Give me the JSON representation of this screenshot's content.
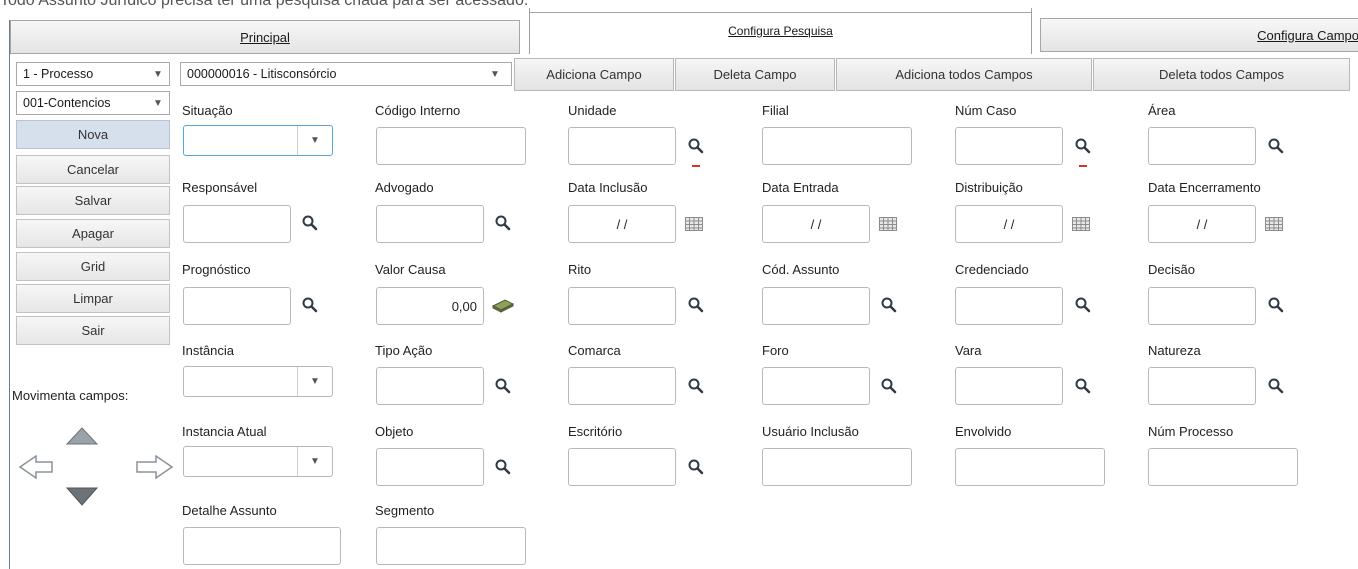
{
  "caption": "Todo Assunto Jurídico precisa ter uma pesquisa criada para ser acessado.",
  "tabs": {
    "principal": "Principal",
    "pesquisa": "Configura Pesquisa",
    "campo": "Configura Campo"
  },
  "filters": {
    "tipo": "1 - Processo",
    "pesquisa": "000000016 - Litisconsórcio",
    "assunto": "001-Contencios"
  },
  "toolbar": {
    "adiciona": "Adiciona Campo",
    "deleta": "Deleta Campo",
    "adiciona_todos": "Adiciona todos Campos",
    "deleta_todos": "Deleta todos Campos"
  },
  "sidebar": {
    "buttons": [
      "Nova",
      "Cancelar",
      "Salvar",
      "Apagar",
      "Grid",
      "Limpar",
      "Sair"
    ],
    "move_label": "Movimenta campos:"
  },
  "fields": {
    "situacao": "Situação",
    "codigo_interno": "Código Interno",
    "unidade": "Unidade",
    "filial": "Filial",
    "num_caso": "Núm Caso",
    "area": "Área",
    "responsavel": "Responsável",
    "advogado": "Advogado",
    "data_inclusao": "Data Inclusão",
    "data_entrada": "Data Entrada",
    "distribuicao": "Distribuição",
    "data_encerramento": "Data Encerramento",
    "prognostico": "Prognóstico",
    "valor_causa": "Valor Causa",
    "rito": "Rito",
    "cod_assunto": "Cód. Assunto",
    "credenciado": "Credenciado",
    "decisao": "Decisão",
    "instancia": "Instância",
    "tipo_acao": "Tipo Ação",
    "comarca": "Comarca",
    "foro": "Foro",
    "vara": "Vara",
    "natureza": "Natureza",
    "instancia_atual": "Instancia Atual",
    "objeto": "Objeto",
    "escritorio": "Escritório",
    "usuario_inclusao": "Usuário Inclusão",
    "envolvido": "Envolvido",
    "num_processo": "Núm Processo",
    "detalhe_assunto": "Detalhe Assunto",
    "segmento": "Segmento"
  },
  "values": {
    "valor_causa": "0,00",
    "date_mask": "/ /"
  },
  "icons": {
    "lookup": "magnifier-icon",
    "calendar": "calendar-icon",
    "money": "money-icon",
    "arrows": [
      "arrow-up-icon",
      "arrow-left-icon",
      "arrow-right-icon",
      "arrow-down-icon"
    ]
  },
  "colors": {
    "accent_focus": "#58a6d8",
    "active_button": "#d6e0ec",
    "required_mark": "#e0302a"
  }
}
